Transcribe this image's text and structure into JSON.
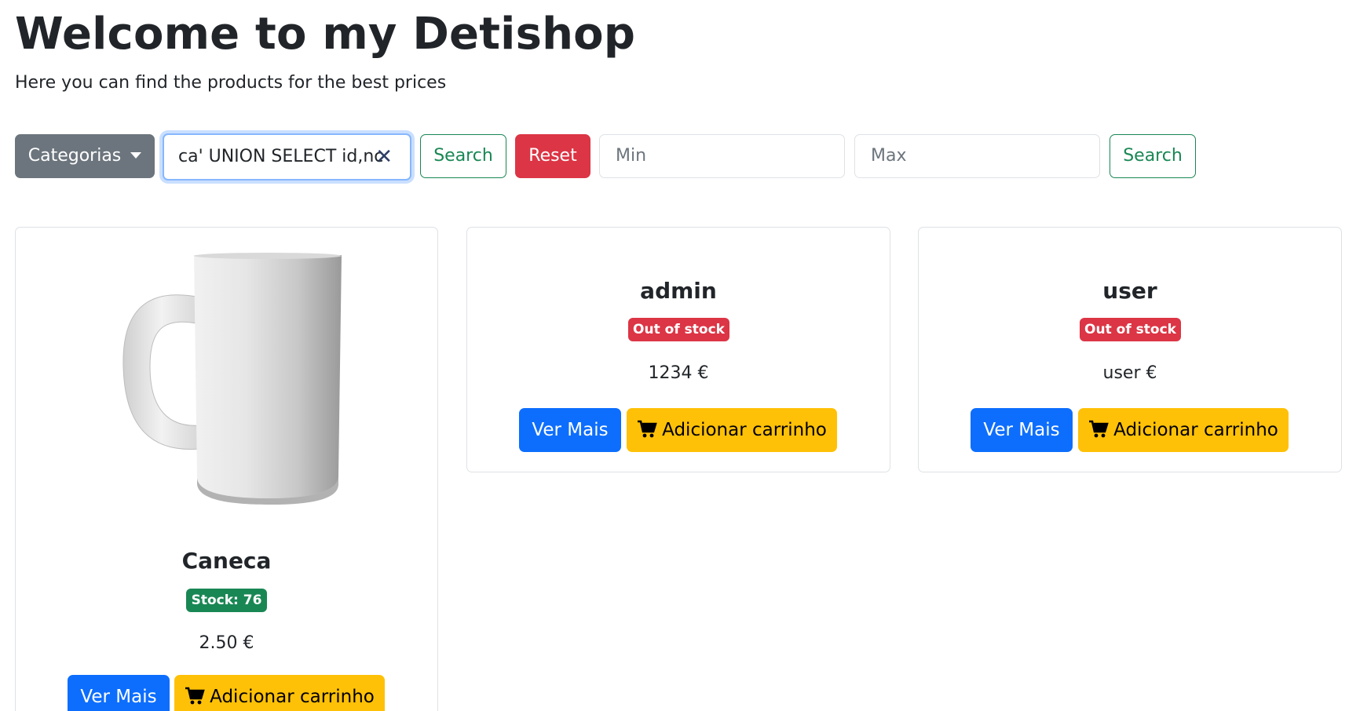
{
  "header": {
    "title": "Welcome to my Detishop",
    "subtitle": "Here you can find the products for the best prices"
  },
  "toolbar": {
    "categories_label": "Categorias",
    "search_value": "ca' UNION SELECT id,nc",
    "search_button": "Search",
    "reset_button": "Reset",
    "min_placeholder": "Min",
    "max_placeholder": "Max",
    "price_search_button": "Search"
  },
  "products": [
    {
      "name": "Caneca",
      "badge": "Stock: 76",
      "price": "2.50 €",
      "more_label": "Ver Mais",
      "cart_label": "Adicionar carrinho"
    },
    {
      "name": "admin",
      "badge": "Out of stock",
      "price": "1234 €",
      "more_label": "Ver Mais",
      "cart_label": "Adicionar carrinho"
    },
    {
      "name": "user",
      "badge": "Out of stock",
      "price": "user €",
      "more_label": "Ver Mais",
      "cart_label": "Adicionar carrinho"
    }
  ],
  "colors": {
    "primary": "#0d6efd",
    "warning": "#ffc107",
    "danger": "#dc3545",
    "success": "#198754",
    "secondary": "#6c757d"
  },
  "icons": {
    "clear": "close-icon",
    "cart": "cart-icon",
    "dropdown": "chevron-down-icon"
  }
}
